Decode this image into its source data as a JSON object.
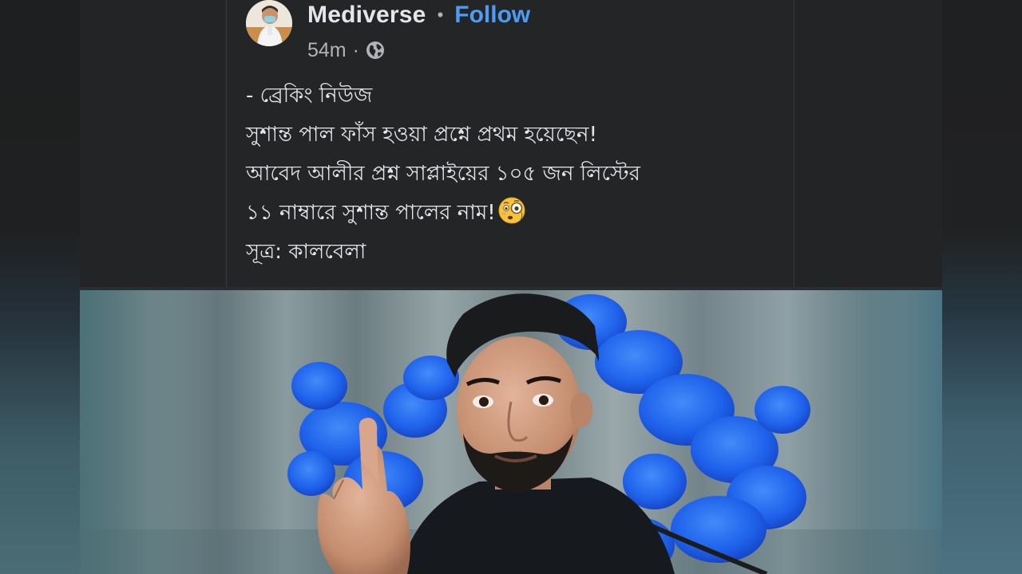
{
  "post": {
    "author": "Mediverse",
    "separator": "•",
    "follow_label": "Follow",
    "timestamp": "54m",
    "meta_separator": "·",
    "privacy_icon": "globe-icon",
    "lines": [
      "- ব্রেকিং নিউজ",
      "সুশান্ত পাল ফাঁস হওয়া প্রশ্নে প্রথম হয়েছেন!",
      "আবেদ আলীর প্রশ্ন সাপ্লাইয়ের ১০৫ জন লিস্টের",
      "১১ নাম্বারে সুশান্ত পালের নাম!",
      "সূত্র: কালবেলা"
    ],
    "emoji_icon": "flushed-face-with-monocle-icon"
  },
  "colors": {
    "card_bg": "#242526",
    "text": "#e4e6eb",
    "muted": "#b0b3b8",
    "link": "#4c9bf4"
  }
}
